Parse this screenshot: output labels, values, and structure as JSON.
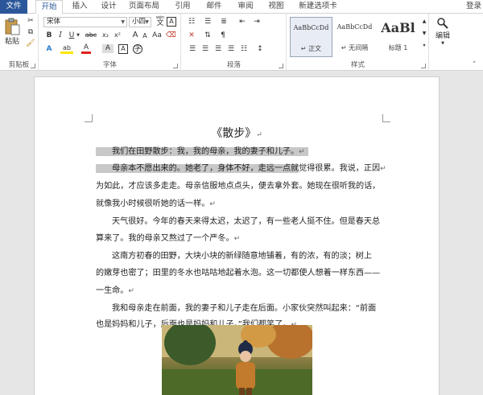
{
  "tabs": [
    {
      "label": "文件",
      "id": "file"
    },
    {
      "label": "开始",
      "id": "home"
    },
    {
      "label": "插入",
      "id": "insert"
    },
    {
      "label": "设计",
      "id": "design"
    },
    {
      "label": "页面布局",
      "id": "layout"
    },
    {
      "label": "引用",
      "id": "references"
    },
    {
      "label": "邮件",
      "id": "mailings"
    },
    {
      "label": "审阅",
      "id": "review"
    },
    {
      "label": "视图",
      "id": "view"
    },
    {
      "label": "新建选项卡",
      "id": "newtab"
    }
  ],
  "login": "登录",
  "ribbon": {
    "clipboard": {
      "paste_label": "粘贴",
      "group_label": "剪贴板"
    },
    "font": {
      "font_name": "宋体",
      "font_size": "小四",
      "group_label": "字体",
      "wen": "wén",
      "change_case": "Aa",
      "grow_font": "A",
      "shrink_font": "A",
      "bold": "B",
      "italic": "I",
      "underline": "U",
      "strike": "abc",
      "subscript": "x₂",
      "superscript": "x²",
      "text_effect": "A",
      "highlight": "ab",
      "font_color": "A",
      "char_shading": "A",
      "enclose": "字",
      "clear_format": "A"
    },
    "paragraph": {
      "group_label": "段落"
    },
    "styles": {
      "items": [
        {
          "preview": "AaBbCcDd",
          "name": "↵ 正文"
        },
        {
          "preview": "AaBbCcDd",
          "name": "↵ 无间隔"
        },
        {
          "preview": "AaBl",
          "name": "标题 1"
        }
      ],
      "group_label": "样式"
    },
    "editing": {
      "label": "编辑"
    }
  },
  "document": {
    "title": "《散步》",
    "lines": [
      {
        "text": "我们在田野散步：我，我的母亲，我的妻子和儿子。",
        "indent": true,
        "highlight": "full"
      },
      {
        "text": "母亲本不愿出来的。她老了，身体不好，走远一点就",
        "rest": "觉得很累。我说，正因",
        "indent": true,
        "highlight": "partial"
      },
      {
        "text": "为如此，才应该多走走。母亲信服地点点头，便去拿外套。她现在很听我的话，",
        "indent": false
      },
      {
        "text": "就像我小时候很听她的话一样。",
        "indent": false
      },
      {
        "text": "天气很好。今年的春天来得太迟，太迟了，有一些老人挺不住。但是春天总",
        "indent": true
      },
      {
        "text": "算来了。我的母亲又熬过了一个严冬。",
        "indent": false
      },
      {
        "text": "这南方初春的田野，大块小块的新绿随意地铺着，有的浓，有的淡；树上",
        "indent": true
      },
      {
        "text": "的嫩芽也密了；田里的冬水也咕咕地起着水泡。这一切都使人想着一样东西——",
        "indent": false
      },
      {
        "text": "一生命。",
        "indent": false
      },
      {
        "text": "我和母亲走在前面，我的妻子和儿子走在后面。小家伙突然叫起来：“前面",
        "indent": true
      },
      {
        "text": "也是妈妈和儿子，后面也是妈妈和儿子。”我们都笑了。",
        "indent": false
      }
    ],
    "paragraph_mark": "↵"
  }
}
